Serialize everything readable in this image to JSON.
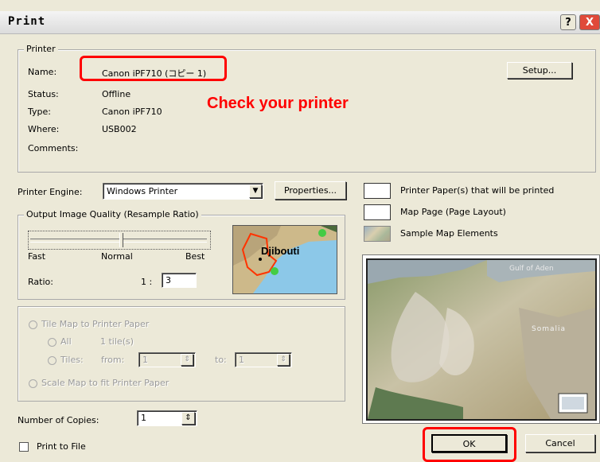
{
  "window": {
    "title": "Print",
    "help_label": "?",
    "close_label": "X"
  },
  "printer": {
    "group_label": "Printer",
    "name_label": "Name:",
    "name_value": "Canon iPF710 (コピー 1)",
    "status_label": "Status:",
    "status_value": "Offline",
    "type_label": "Type:",
    "type_value": "Canon iPF710",
    "where_label": "Where:",
    "where_value": "USB002",
    "comments_label": "Comments:",
    "setup_label": "Setup..."
  },
  "annotation": {
    "check_printer": "Check your printer",
    "color": "#ff0000"
  },
  "engine": {
    "label": "Printer Engine:",
    "value": "Windows Printer",
    "properties_label": "Properties..."
  },
  "quality": {
    "group_label": "Output Image Quality (Resample Ratio)",
    "fast": "Fast",
    "normal": "Normal",
    "best": "Best",
    "ratio_label": "Ratio:",
    "ratio_prefix": "1 :",
    "ratio_value": "3",
    "thumb_label": "Djibouti"
  },
  "tiling": {
    "tile_option": "Tile Map to Printer Paper",
    "all_option": "All",
    "all_count": "1 tile(s)",
    "tiles_option": "Tiles:",
    "from_label": "from:",
    "from_value": "1",
    "to_label": "to:",
    "to_value": "1",
    "scale_option": "Scale Map to fit Printer Paper"
  },
  "copies": {
    "label": "Number of Copies:",
    "value": "1"
  },
  "print_to_file": {
    "label": "Print to File"
  },
  "legend": {
    "paper": "Printer Paper(s) that will be printed",
    "page": "Map Page (Page Layout)",
    "elements": "Sample Map Elements"
  },
  "preview": {
    "somalia": "Somalia",
    "gulf": "Gulf of Aden"
  },
  "buttons": {
    "ok": "OK",
    "cancel": "Cancel"
  }
}
